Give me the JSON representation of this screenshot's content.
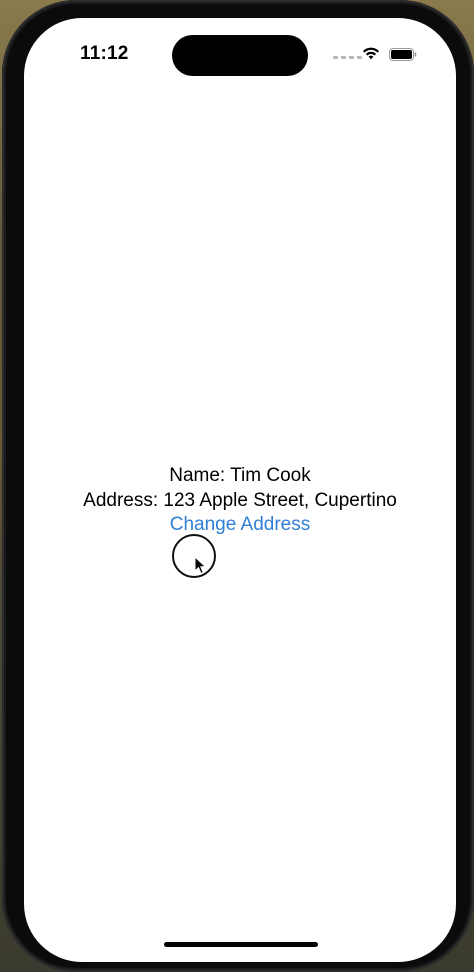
{
  "status_bar": {
    "time": "11:12",
    "wifi_icon": "wifi-icon",
    "battery_icon": "battery-icon",
    "signal_icon": "signal-dots-icon"
  },
  "profile": {
    "name_line": "Name: Tim Cook",
    "address_line": "Address: 123 Apple Street, Cupertino",
    "change_address_label": "Change Address"
  },
  "colors": {
    "link": "#2f7fd6",
    "text": "#000000",
    "background": "#ffffff"
  }
}
